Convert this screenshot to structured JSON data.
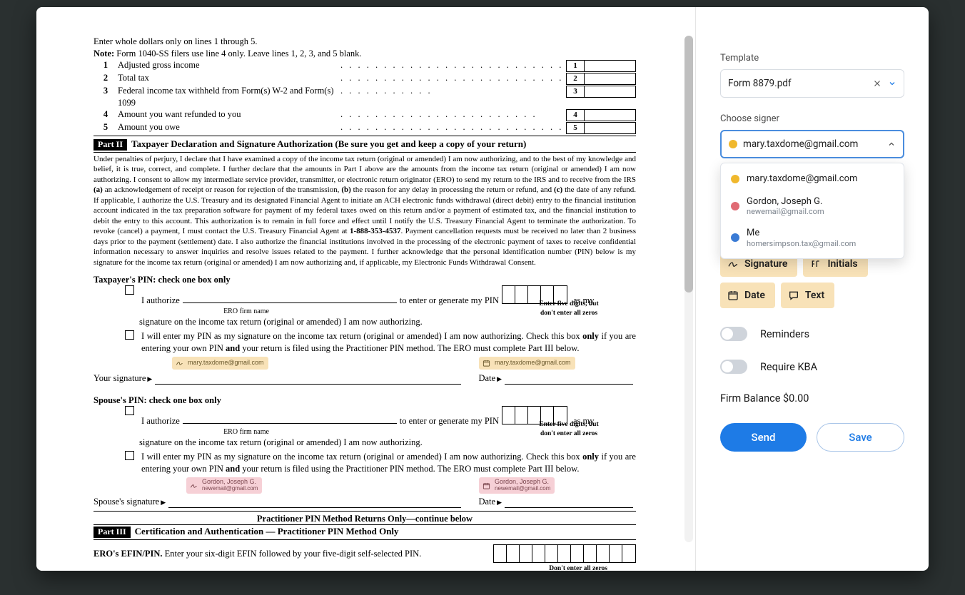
{
  "doc": {
    "intro1": "Enter whole dollars only on lines 1 through 5.",
    "note_label": "Note:",
    "note_text": " Form 1040-SS filers use line 4 only. Leave lines 1, 2, 3, and 5 blank.",
    "lines": [
      {
        "n": "1",
        "t": "Adjusted gross income"
      },
      {
        "n": "2",
        "t": "Total tax"
      },
      {
        "n": "3",
        "t": "Federal income tax withheld from Form(s) W-2 and Form(s) 1099"
      },
      {
        "n": "4",
        "t": "Amount you want refunded to you"
      },
      {
        "n": "5",
        "t": "Amount you owe"
      }
    ],
    "part2_label": "Part II",
    "part2_title": "Taxpayer Declaration and Signature Authorization (Be sure you get and keep a copy of your return)",
    "decl1": "Under penalties of perjury, I declare that I have examined a copy of the income tax return (original or amended) I am now authorizing, and to the best of my knowledge and belief, it is true, correct, and complete. I further declare that the amounts in Part I above are the amounts from the income tax return (original or amended) I am now authorizing. I consent to allow my intermediate service provider, transmitter, or electronic return originator (ERO) to send my return to the IRS and to receive from the IRS ",
    "decl_a": "(a)",
    "decl_a_t": " an acknowledgement of receipt or reason for rejection of the transmission, ",
    "decl_b": "(b)",
    "decl_b_t": " the reason for any delay in processing the return or refund, and ",
    "decl_c": "(c)",
    "decl_c_t": " the date of any refund. If applicable, I authorize the U.S. Treasury and its designated Financial Agent to initiate an ACH electronic funds withdrawal (direct debit) entry to the financial institution account indicated in the tax preparation software for payment of my federal taxes owed on this return and/or a payment of estimated tax, and the financial institution to debit the entry to this account. This authorization is to remain in full force and effect until I notify the U.S. Treasury Financial Agent to terminate the authorization. To revoke (cancel) a payment, I must contact the U.S. Treasury Financial Agent at ",
    "decl_phone": "1-888-353-4537",
    "decl2": ". Payment cancellation requests must be received no later than 2 business days prior to the payment (settlement) date. I also authorize the financial institutions involved in the processing of the electronic payment of taxes to receive confidential information necessary to answer inquiries and resolve issues related to the payment. I further acknowledge that the personal identification number (PIN) below is my signature for the income tax return (original or amended) I am now authorizing and, if applicable, my Electronic Funds Withdrawal Consent.",
    "tp_pin_hdr": "Taxpayer's PIN: check one box only",
    "sp_pin_hdr": "Spouse's PIN: check one box only",
    "auth1a": "I authorize",
    "auth1b": "to enter or generate my PIN",
    "auth1c": "as my",
    "ero_firm": "ERO firm name",
    "pin_note": "Enter five digits, but don't enter all zeros",
    "auth2": "signature on the income tax return (original or amended) I am now authorizing.",
    "auth3a": "I will enter my PIN as my signature on the income tax return (original or amended) I am now authorizing. Check this box ",
    "only": "only",
    "auth3b": " if you are entering your own PIN ",
    "and": "and",
    "auth3c": " your return is filed using the Practitioner PIN method. The ERO must complete Part III below.",
    "your_sig": "Your signature",
    "sp_sig": "Spouse's signature",
    "date": "Date",
    "part3_bar": "Practitioner PIN Method Returns Only—continue below",
    "part3_label": "Part III",
    "part3_title": "Certification and Authentication — Practitioner PIN Method Only",
    "ero_efin_lbl": "ERO's EFIN/PIN.",
    "ero_efin_txt": " Enter your six-digit EFIN followed by your five-digit self-selected PIN.",
    "dont_zero": "Don't enter all zeros",
    "tags": {
      "mary": "mary.taxdome@gmail.com",
      "gordon_name": "Gordon, Joseph G.",
      "gordon_email": "newemail@gmail.com"
    }
  },
  "sidebar": {
    "template_lbl": "Template",
    "template_val": "Form 8879.pdf",
    "signer_lbl": "Choose signer",
    "signer_val": "mary.taxdome@gmail.com",
    "options": [
      {
        "dot": "d-yel",
        "label": "mary.taxdome@gmail.com",
        "sub": ""
      },
      {
        "dot": "d-red",
        "label": "Gordon, Joseph G.",
        "sub": "newemail@gmail.com"
      },
      {
        "dot": "d-blu",
        "label": "Me",
        "sub": "homersimpson.tax@gmail.com"
      }
    ],
    "chips": {
      "signature": "Signature",
      "initials": "Initials",
      "date": "Date",
      "text": "Text"
    },
    "reminders": "Reminders",
    "kba": "Require KBA",
    "balance_lbl": "Firm Balance ",
    "balance_val": "$0.00",
    "send": "Send",
    "save": "Save"
  }
}
